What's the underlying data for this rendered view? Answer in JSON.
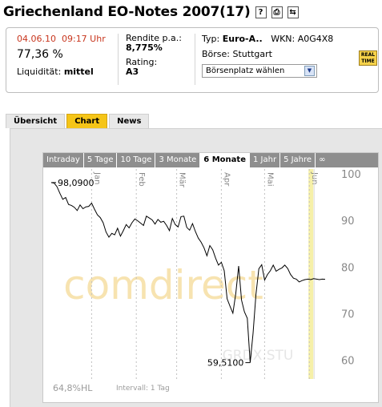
{
  "header": {
    "title": "Griechenland EO-Notes 2007(17)",
    "icons": [
      "help-icon",
      "print-icon",
      "refresh-icon"
    ],
    "icon_glyphs": [
      "?",
      "⎙",
      "⇆"
    ]
  },
  "quote": {
    "date": "04.06.10",
    "time": "09:17 Uhr",
    "price": "77,36 %",
    "liquidity_label": "Liquidität:",
    "liquidity_value": "mittel",
    "yield_label": "Rendite p.a.:",
    "yield_value": "8,775%",
    "rating_label": "Rating:",
    "rating_value": "A3",
    "type_label": "Typ:",
    "type_value": "Euro-A..",
    "wkn_label": "WKN:",
    "wkn_value": "A0G4X8",
    "exchange_label": "Börse:",
    "exchange_value": "Stuttgart",
    "exchange_select": "Börsenplatz wählen",
    "realtime_line1": "REAL",
    "realtime_line2": "TIME"
  },
  "tabs": [
    {
      "label": "Übersicht",
      "active": false
    },
    {
      "label": "Chart",
      "active": true
    },
    {
      "label": "News",
      "active": false
    }
  ],
  "range_tabs": [
    {
      "label": "Intraday",
      "active": false
    },
    {
      "label": "5 Tage",
      "active": false
    },
    {
      "label": "10 Tage",
      "active": false
    },
    {
      "label": "3 Monate",
      "active": false
    },
    {
      "label": "6 Monate",
      "active": true
    },
    {
      "label": "1 Jahr",
      "active": false
    },
    {
      "label": "5 Jahre",
      "active": false
    },
    {
      "label": "∞",
      "active": false
    }
  ],
  "footer": {
    "hl_value": "64,8",
    "hl_label": "%HL",
    "interval": "Intervall: 1 Tag"
  },
  "watermark": "comdirect",
  "watermark_small": "GRDX.STU",
  "chart_data": {
    "type": "line",
    "months": [
      "Jan",
      "Feb",
      "Mär",
      "Apr",
      "Mai",
      "Jun"
    ],
    "month_day_offsets": [
      28,
      59,
      87,
      118,
      148,
      179
    ],
    "ylim": [
      56,
      101
    ],
    "y_ticks": [
      100,
      90,
      80,
      70,
      60
    ],
    "max_label": "98,0900",
    "min_label": "59,5100",
    "max_value": 98.09,
    "min_value": 59.51,
    "x": [
      0,
      2,
      4,
      6,
      8,
      10,
      12,
      14,
      16,
      18,
      20,
      22,
      24,
      26,
      28,
      30,
      32,
      34,
      36,
      38,
      40,
      42,
      44,
      46,
      48,
      50,
      52,
      54,
      56,
      58,
      60,
      62,
      64,
      66,
      68,
      70,
      72,
      74,
      76,
      78,
      80,
      82,
      84,
      86,
      88,
      90,
      92,
      94,
      96,
      98,
      100,
      102,
      104,
      106,
      108,
      110,
      112,
      114,
      116,
      118,
      120,
      122,
      124,
      126,
      128,
      130,
      132,
      134,
      136,
      138,
      140,
      142,
      144,
      146,
      148,
      150,
      152,
      154,
      156,
      158,
      160,
      162,
      164,
      166,
      168,
      170,
      172,
      174,
      176,
      178,
      180,
      182,
      184,
      186,
      188,
      190
    ],
    "values": [
      98.1,
      98.0,
      97.2,
      95.8,
      94.5,
      94.9,
      93.4,
      93.2,
      92.8,
      92.1,
      93.3,
      92.5,
      92.9,
      93.0,
      93.7,
      92.4,
      91.2,
      90.6,
      89.5,
      87.5,
      86.4,
      87.2,
      86.9,
      88.3,
      86.6,
      87.8,
      89.1,
      88.4,
      89.5,
      90.3,
      89.9,
      89.4,
      88.9,
      90.9,
      90.5,
      90.1,
      89.2,
      90.2,
      89.6,
      89.8,
      88.9,
      87.8,
      90.4,
      89.1,
      88.6,
      90.8,
      90.9,
      88.5,
      87.9,
      89.3,
      87.6,
      86.2,
      85.3,
      84.1,
      82.4,
      84.6,
      83.7,
      81.9,
      80.4,
      81.0,
      79.2,
      73.2,
      71.6,
      70.1,
      74.3,
      80.2,
      72.9,
      70.4,
      69.0,
      59.5,
      65.8,
      74.1,
      79.6,
      80.5,
      77.2,
      78.4,
      79.2,
      80.4,
      79.1,
      79.5,
      79.8,
      80.4,
      79.7,
      78.4,
      77.6,
      77.4,
      76.8,
      77.1,
      77.3,
      77.4,
      77.3,
      77.5,
      77.4,
      77.3,
      77.4,
      77.36
    ]
  }
}
